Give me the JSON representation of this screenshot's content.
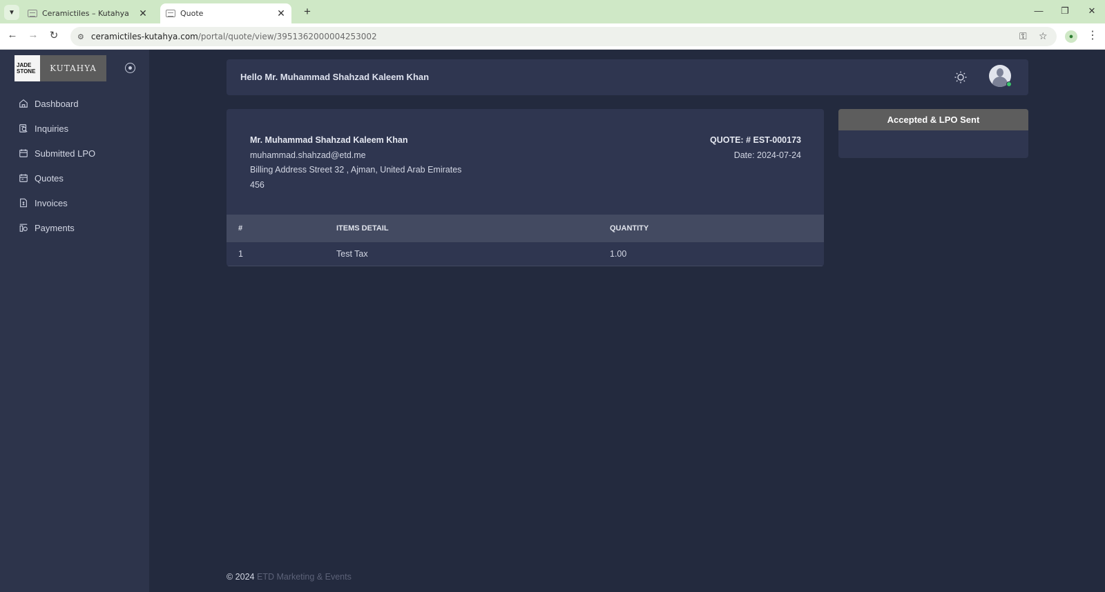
{
  "browser": {
    "tabs": [
      {
        "title": "Ceramictiles – Kutahya",
        "active": false
      },
      {
        "title": "Quote",
        "active": true
      }
    ],
    "url_host": "ceramictiles-kutahya.com",
    "url_path": "/portal/quote/view/3951362000004253002"
  },
  "logo": {
    "left_line1": "JADE",
    "left_line2": "STONE",
    "right_text": "KUTAHYA"
  },
  "sidebar": {
    "items": [
      {
        "label": "Dashboard",
        "icon": "home-icon"
      },
      {
        "label": "Inquiries",
        "icon": "inquiries-icon"
      },
      {
        "label": "Submitted LPO",
        "icon": "calendar-icon"
      },
      {
        "label": "Quotes",
        "icon": "calendar-icon"
      },
      {
        "label": "Invoices",
        "icon": "invoice-icon"
      },
      {
        "label": "Payments",
        "icon": "payments-icon"
      }
    ]
  },
  "header": {
    "greeting": "Hello Mr. Muhammad Shahzad Kaleem Khan"
  },
  "quote": {
    "customer_name": "Mr. Muhammad Shahzad Kaleem Khan",
    "email": "muhammad.shahzad@etd.me",
    "address": "Billing Address Street 32 , Ajman, United Arab Emirates",
    "postal": "456",
    "number": "QUOTE: # EST-000173",
    "date": "Date: 2024-07-24",
    "columns": [
      "#",
      "ITEMS DETAIL",
      "QUANTITY"
    ],
    "rows": [
      {
        "index": "1",
        "item": "Test Tax",
        "quantity": "1.00"
      }
    ]
  },
  "status": {
    "label": "Accepted & LPO Sent"
  },
  "footer": {
    "copyright": "© 2024",
    "brand": "ETD Marketing & Events"
  }
}
